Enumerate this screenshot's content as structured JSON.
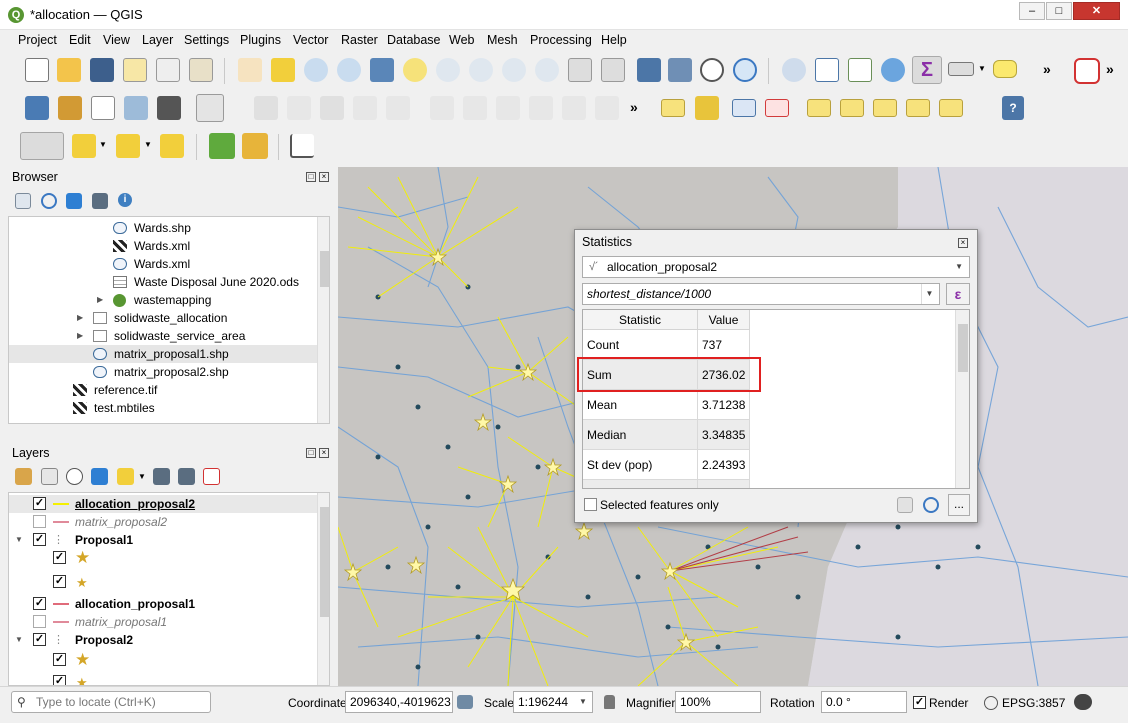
{
  "window": {
    "title": "*allocation — QGIS",
    "app_icon": "Q"
  },
  "menu": [
    "Project",
    "Edit",
    "View",
    "Layer",
    "Settings",
    "Plugins",
    "Vector",
    "Raster",
    "Database",
    "Web",
    "Mesh",
    "Processing",
    "Help"
  ],
  "browser": {
    "title": "Browser",
    "items": [
      {
        "label": "Wards.shp",
        "icon": "polygon-layer-icon"
      },
      {
        "label": "Wards.xml",
        "icon": "raster-file-icon"
      },
      {
        "label": "Wards.xml",
        "icon": "polygon-layer-icon"
      },
      {
        "label": "Waste Disposal June 2020.ods",
        "icon": "table-file-icon"
      },
      {
        "label": "wastemapping",
        "icon": "qgis-project-icon"
      },
      {
        "label": "solidwaste_allocation",
        "icon": "folder-icon"
      },
      {
        "label": "solidwaste_service_area",
        "icon": "folder-icon"
      },
      {
        "label": "matrix_proposal1.shp",
        "icon": "polygon-layer-icon"
      },
      {
        "label": "matrix_proposal2.shp",
        "icon": "polygon-layer-icon"
      },
      {
        "label": "reference.tif",
        "icon": "raster-file-icon"
      },
      {
        "label": "test.mbtiles",
        "icon": "raster-file-icon"
      }
    ]
  },
  "layers": {
    "title": "Layers",
    "items": [
      {
        "label": "allocation_proposal2",
        "checked": true,
        "style": "bold"
      },
      {
        "label": "matrix_proposal2",
        "checked": false,
        "style": "italic"
      },
      {
        "label": "Proposal1",
        "checked": true,
        "style": "bold"
      },
      {
        "label": "",
        "checked": true,
        "style": "star-large"
      },
      {
        "label": "",
        "checked": true,
        "style": "star-small"
      },
      {
        "label": "allocation_proposal1",
        "checked": true,
        "style": "bold"
      },
      {
        "label": "matrix_proposal1",
        "checked": false,
        "style": "italic"
      },
      {
        "label": "Proposal2",
        "checked": true,
        "style": "bold"
      },
      {
        "label": "",
        "checked": true,
        "style": "star-large"
      },
      {
        "label": "",
        "checked": true,
        "style": "star-small"
      }
    ]
  },
  "statistics": {
    "title": "Statistics",
    "layer": "allocation_proposal2",
    "expression": "shortest_distance/1000",
    "columns": [
      "Statistic",
      "Value"
    ],
    "rows": [
      {
        "name": "Count",
        "value": "737"
      },
      {
        "name": "Sum",
        "value": "2736.02"
      },
      {
        "name": "Mean",
        "value": "3.71238"
      },
      {
        "name": "Median",
        "value": "3.34835"
      },
      {
        "name": "St dev (pop)",
        "value": "2.24393"
      }
    ],
    "selected_only_label": "Selected features only",
    "more_button": "..."
  },
  "status": {
    "locate_placeholder": "Type to locate (Ctrl+K)",
    "coordinate_label": "Coordinate",
    "coordinate": "2096340,-4019623",
    "scale_label": "Scale",
    "scale": "1:196244",
    "magnifier_label": "Magnifier",
    "magnifier": "100%",
    "rotation_label": "Rotation",
    "rotation": "0.0 °",
    "render_label": "Render",
    "crs": "EPSG:3857"
  },
  "colors": {
    "map_background": "#d9d6dc",
    "land": "#c9c7c4",
    "roads": "#6da0d8",
    "allocation_lines": "#f4f000",
    "highlight": "#e02020"
  }
}
